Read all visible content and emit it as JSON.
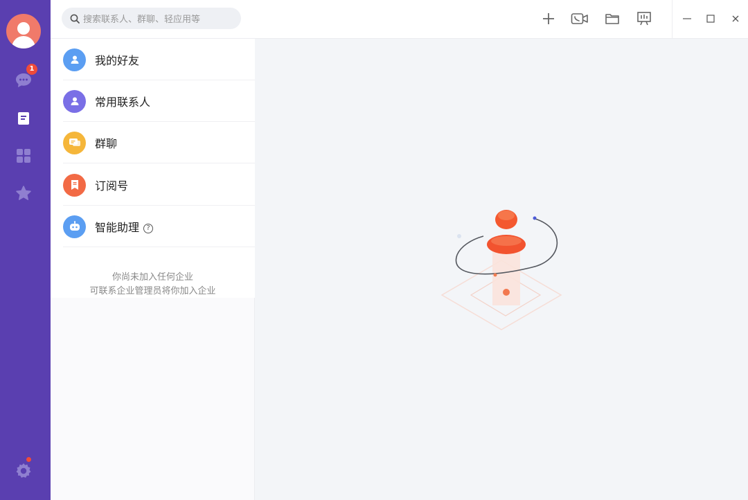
{
  "rail": {
    "chat_badge": "1",
    "active": "contacts"
  },
  "search": {
    "placeholder": "搜索联系人、群聊、轻应用等"
  },
  "contacts": [
    {
      "label": "我的好友",
      "color": "#5b9ef2",
      "icon": "friend-icon"
    },
    {
      "label": "常用联系人",
      "color": "#7a6fe6",
      "icon": "frequent-contact-icon"
    },
    {
      "label": "群聊",
      "color": "#f5b63a",
      "icon": "group-chat-icon"
    },
    {
      "label": "订阅号",
      "color": "#f26a45",
      "icon": "subscription-icon"
    },
    {
      "label": "智能助理",
      "color": "#5b9ef2",
      "icon": "assistant-robot-icon"
    }
  ],
  "help_glyph": "?",
  "note": {
    "line1": "你尚未加入任何企业",
    "line2": "可联系企业管理员将你加入企业"
  },
  "colors": {
    "rail": "#5a3fb0",
    "badge": "#f04b3a",
    "accent_orange": "#f25a3a"
  }
}
